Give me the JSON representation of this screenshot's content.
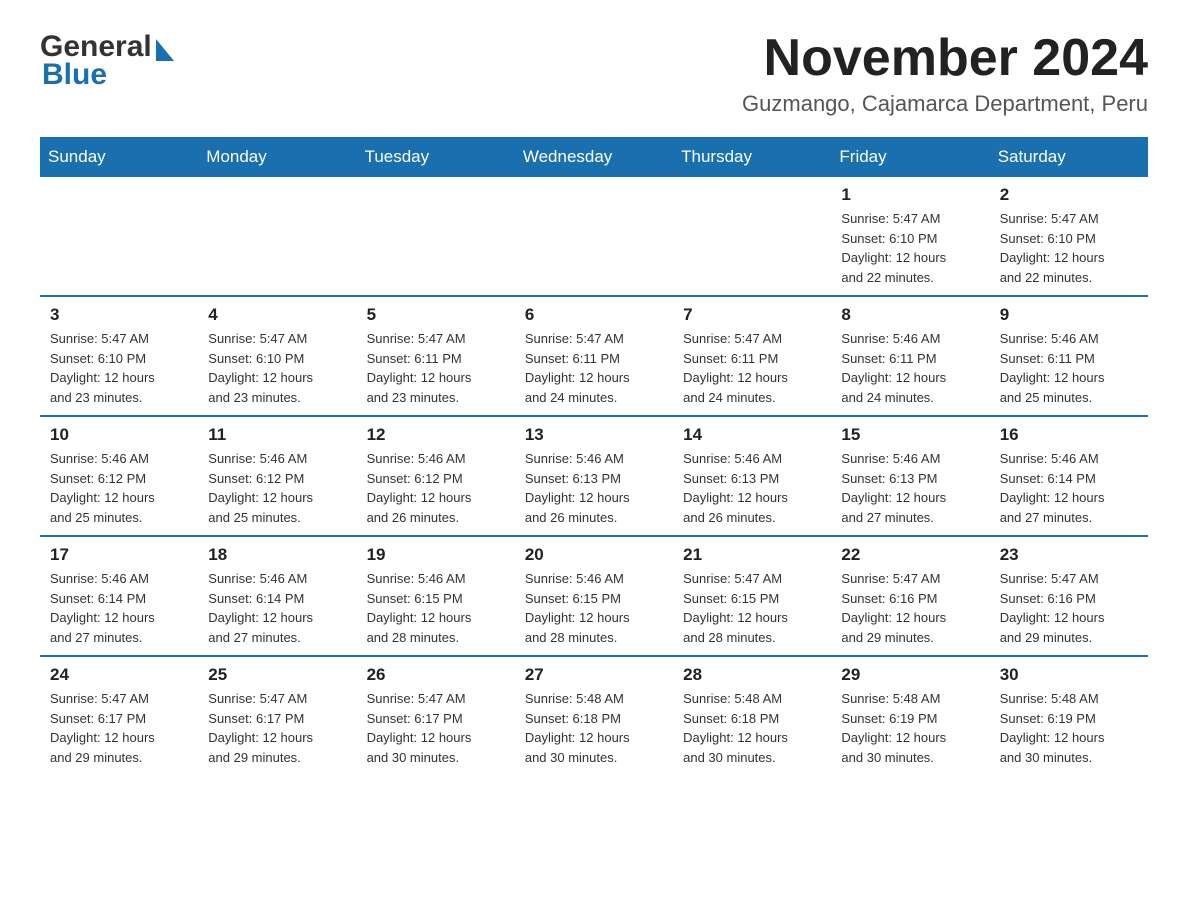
{
  "header": {
    "logo": {
      "general": "General",
      "blue": "Blue"
    },
    "title": "November 2024",
    "location": "Guzmango, Cajamarca Department, Peru"
  },
  "days_of_week": [
    "Sunday",
    "Monday",
    "Tuesday",
    "Wednesday",
    "Thursday",
    "Friday",
    "Saturday"
  ],
  "weeks": [
    [
      {
        "day": "",
        "info": ""
      },
      {
        "day": "",
        "info": ""
      },
      {
        "day": "",
        "info": ""
      },
      {
        "day": "",
        "info": ""
      },
      {
        "day": "",
        "info": ""
      },
      {
        "day": "1",
        "info": "Sunrise: 5:47 AM\nSunset: 6:10 PM\nDaylight: 12 hours\nand 22 minutes."
      },
      {
        "day": "2",
        "info": "Sunrise: 5:47 AM\nSunset: 6:10 PM\nDaylight: 12 hours\nand 22 minutes."
      }
    ],
    [
      {
        "day": "3",
        "info": "Sunrise: 5:47 AM\nSunset: 6:10 PM\nDaylight: 12 hours\nand 23 minutes."
      },
      {
        "day": "4",
        "info": "Sunrise: 5:47 AM\nSunset: 6:10 PM\nDaylight: 12 hours\nand 23 minutes."
      },
      {
        "day": "5",
        "info": "Sunrise: 5:47 AM\nSunset: 6:11 PM\nDaylight: 12 hours\nand 23 minutes."
      },
      {
        "day": "6",
        "info": "Sunrise: 5:47 AM\nSunset: 6:11 PM\nDaylight: 12 hours\nand 24 minutes."
      },
      {
        "day": "7",
        "info": "Sunrise: 5:47 AM\nSunset: 6:11 PM\nDaylight: 12 hours\nand 24 minutes."
      },
      {
        "day": "8",
        "info": "Sunrise: 5:46 AM\nSunset: 6:11 PM\nDaylight: 12 hours\nand 24 minutes."
      },
      {
        "day": "9",
        "info": "Sunrise: 5:46 AM\nSunset: 6:11 PM\nDaylight: 12 hours\nand 25 minutes."
      }
    ],
    [
      {
        "day": "10",
        "info": "Sunrise: 5:46 AM\nSunset: 6:12 PM\nDaylight: 12 hours\nand 25 minutes."
      },
      {
        "day": "11",
        "info": "Sunrise: 5:46 AM\nSunset: 6:12 PM\nDaylight: 12 hours\nand 25 minutes."
      },
      {
        "day": "12",
        "info": "Sunrise: 5:46 AM\nSunset: 6:12 PM\nDaylight: 12 hours\nand 26 minutes."
      },
      {
        "day": "13",
        "info": "Sunrise: 5:46 AM\nSunset: 6:13 PM\nDaylight: 12 hours\nand 26 minutes."
      },
      {
        "day": "14",
        "info": "Sunrise: 5:46 AM\nSunset: 6:13 PM\nDaylight: 12 hours\nand 26 minutes."
      },
      {
        "day": "15",
        "info": "Sunrise: 5:46 AM\nSunset: 6:13 PM\nDaylight: 12 hours\nand 27 minutes."
      },
      {
        "day": "16",
        "info": "Sunrise: 5:46 AM\nSunset: 6:14 PM\nDaylight: 12 hours\nand 27 minutes."
      }
    ],
    [
      {
        "day": "17",
        "info": "Sunrise: 5:46 AM\nSunset: 6:14 PM\nDaylight: 12 hours\nand 27 minutes."
      },
      {
        "day": "18",
        "info": "Sunrise: 5:46 AM\nSunset: 6:14 PM\nDaylight: 12 hours\nand 27 minutes."
      },
      {
        "day": "19",
        "info": "Sunrise: 5:46 AM\nSunset: 6:15 PM\nDaylight: 12 hours\nand 28 minutes."
      },
      {
        "day": "20",
        "info": "Sunrise: 5:46 AM\nSunset: 6:15 PM\nDaylight: 12 hours\nand 28 minutes."
      },
      {
        "day": "21",
        "info": "Sunrise: 5:47 AM\nSunset: 6:15 PM\nDaylight: 12 hours\nand 28 minutes."
      },
      {
        "day": "22",
        "info": "Sunrise: 5:47 AM\nSunset: 6:16 PM\nDaylight: 12 hours\nand 29 minutes."
      },
      {
        "day": "23",
        "info": "Sunrise: 5:47 AM\nSunset: 6:16 PM\nDaylight: 12 hours\nand 29 minutes."
      }
    ],
    [
      {
        "day": "24",
        "info": "Sunrise: 5:47 AM\nSunset: 6:17 PM\nDaylight: 12 hours\nand 29 minutes."
      },
      {
        "day": "25",
        "info": "Sunrise: 5:47 AM\nSunset: 6:17 PM\nDaylight: 12 hours\nand 29 minutes."
      },
      {
        "day": "26",
        "info": "Sunrise: 5:47 AM\nSunset: 6:17 PM\nDaylight: 12 hours\nand 30 minutes."
      },
      {
        "day": "27",
        "info": "Sunrise: 5:48 AM\nSunset: 6:18 PM\nDaylight: 12 hours\nand 30 minutes."
      },
      {
        "day": "28",
        "info": "Sunrise: 5:48 AM\nSunset: 6:18 PM\nDaylight: 12 hours\nand 30 minutes."
      },
      {
        "day": "29",
        "info": "Sunrise: 5:48 AM\nSunset: 6:19 PM\nDaylight: 12 hours\nand 30 minutes."
      },
      {
        "day": "30",
        "info": "Sunrise: 5:48 AM\nSunset: 6:19 PM\nDaylight: 12 hours\nand 30 minutes."
      }
    ]
  ]
}
